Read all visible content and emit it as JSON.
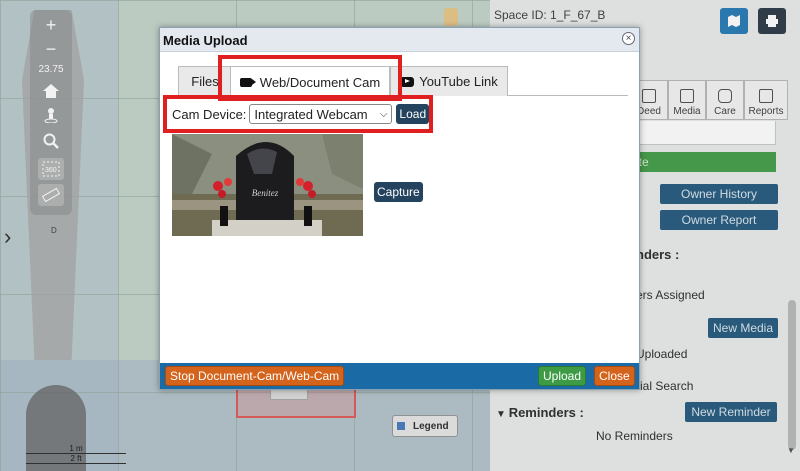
{
  "map": {
    "zoom_in": "+",
    "zoom_out": "−",
    "zoom_level": "23.75",
    "plot_label": "D",
    "legend_label": "Legend",
    "scale_metric": "1 m",
    "scale_imperial": "2 ft"
  },
  "panel": {
    "space_id": "Space ID:  1_F_67_B",
    "icon_tabs": [
      {
        "label": "Deed",
        "icon": "document-icon"
      },
      {
        "label": "Media",
        "icon": "image-icon"
      },
      {
        "label": "Care",
        "icon": "camera-icon"
      },
      {
        "label": "Reports",
        "icon": "list-icon"
      }
    ],
    "green_bar_text": "ate",
    "owner_history_label": "Owner History",
    "owner_report_label": "Owner Report",
    "reminders_partial": "nders :",
    "reminders_assigned_partial": "ers Assigned",
    "new_media_label": "New Media",
    "uploaded_partial": "Uploaded",
    "search_partial": "ial Search",
    "reminders_heading": "Reminders :",
    "new_reminder_label": "New Reminder",
    "no_reminders": "No Reminders"
  },
  "modal": {
    "title": "Media Upload",
    "close_glyph": "×",
    "tabs": [
      {
        "label": "Files",
        "active": false
      },
      {
        "label": "Web/Document Cam",
        "active": true,
        "icon": "video-camera-icon"
      },
      {
        "label": "YouTube Link",
        "active": false,
        "icon": "youtube-icon"
      }
    ],
    "cam_device_label": "Cam Device:",
    "cam_device_value": "Integrated Webcam",
    "load_label": "Load",
    "capture_label": "Capture",
    "preview_text": "Benitez",
    "footer": {
      "stop_label": "Stop Document-Cam/Web-Cam",
      "upload_label": "Upload",
      "close_label": "Close"
    }
  },
  "colors": {
    "modal_footer": "#1a6aa6",
    "orange_button": "#d4641c",
    "green_button": "#3d9b45",
    "dark_button": "#24435f",
    "highlight_red": "#e02020"
  }
}
